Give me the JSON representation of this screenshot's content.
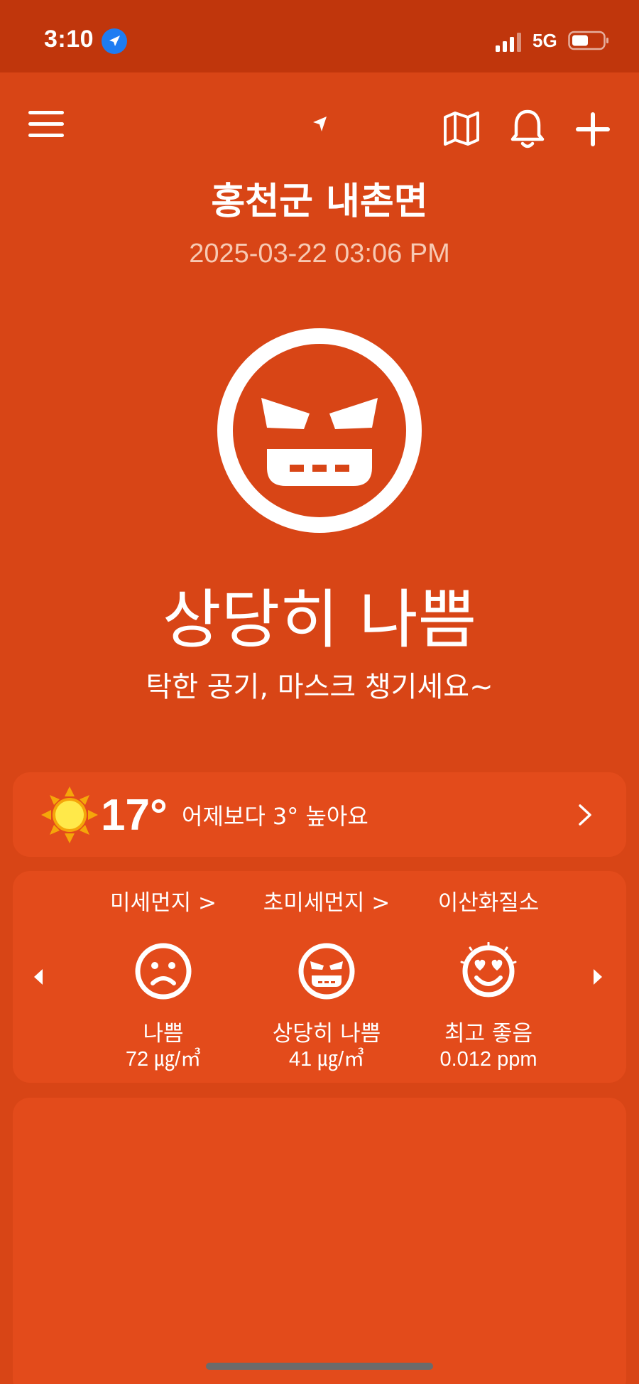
{
  "status_bar": {
    "time": "3:10",
    "network": "5G",
    "icons": [
      "location-arrow-icon",
      "signal-icon",
      "battery-icon"
    ]
  },
  "toolbar": {
    "icons": [
      "menu-icon",
      "navigation-arrow-icon",
      "map-icon",
      "bell-icon",
      "plus-icon"
    ]
  },
  "location": {
    "name": "홍천군 내촌면",
    "timestamp": "2025-03-22 03:06 PM"
  },
  "air_quality": {
    "grade": "상당히 나쁨",
    "message": "탁한 공기, 마스크 챙기세요~",
    "face_icon": "angry-face-icon"
  },
  "weather": {
    "temperature": "17°",
    "comparison": "어제보다 3° 높아요",
    "icon": "sun-icon"
  },
  "pollutants": [
    {
      "name": "미세먼지 >",
      "grade": "나쁨",
      "value": "72 ㎍/㎥",
      "icon": "sad-face-icon"
    },
    {
      "name": "초미세먼지 >",
      "grade": "상당히 나쁨",
      "value": "41 ㎍/㎥",
      "icon": "angry-face-icon"
    },
    {
      "name": "이산화질소",
      "grade": "최고 좋음",
      "value": "0.012 ppm",
      "icon": "heart-eyes-face-icon"
    }
  ],
  "colors": {
    "background": "#d84516",
    "status_bar": "#c0360c",
    "card": "#e34b1b",
    "accent_blue": "#1e7cf2",
    "sun": "#f5a60a"
  }
}
